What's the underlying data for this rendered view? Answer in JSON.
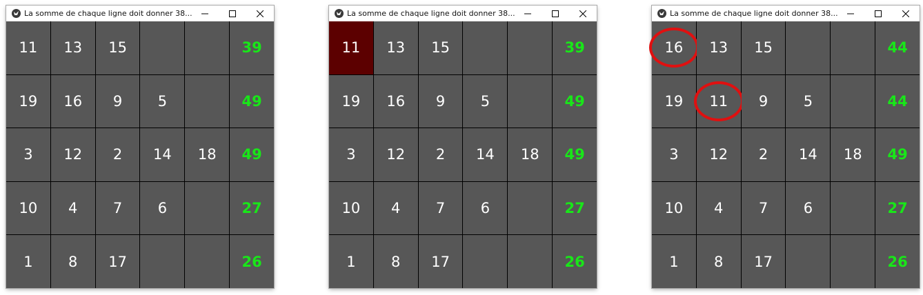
{
  "windows": [
    {
      "title": "La somme de chaque ligne doit donner 38...",
      "rows": [
        {
          "cells": [
            "11",
            "13",
            "15",
            "",
            ""
          ],
          "sum": "39"
        },
        {
          "cells": [
            "19",
            "16",
            "9",
            "5",
            ""
          ],
          "sum": "49"
        },
        {
          "cells": [
            "3",
            "12",
            "2",
            "14",
            "18"
          ],
          "sum": "49"
        },
        {
          "cells": [
            "10",
            "4",
            "7",
            "6",
            ""
          ],
          "sum": "27"
        },
        {
          "cells": [
            "1",
            "8",
            "17",
            "",
            ""
          ],
          "sum": "26"
        }
      ]
    },
    {
      "title": "La somme de chaque ligne doit donner 38...",
      "rows": [
        {
          "cells": [
            "11",
            "13",
            "15",
            "",
            ""
          ],
          "sum": "39"
        },
        {
          "cells": [
            "19",
            "16",
            "9",
            "5",
            ""
          ],
          "sum": "49"
        },
        {
          "cells": [
            "3",
            "12",
            "2",
            "14",
            "18"
          ],
          "sum": "49"
        },
        {
          "cells": [
            "10",
            "4",
            "7",
            "6",
            ""
          ],
          "sum": "27"
        },
        {
          "cells": [
            "1",
            "8",
            "17",
            "",
            ""
          ],
          "sum": "26"
        }
      ],
      "selected_cell": "row 1, column 1"
    },
    {
      "title": "La somme de chaque ligne doit donner 38...",
      "rows": [
        {
          "cells": [
            "16",
            "13",
            "15",
            "",
            ""
          ],
          "sum": "44"
        },
        {
          "cells": [
            "19",
            "11",
            "9",
            "5",
            ""
          ],
          "sum": "44"
        },
        {
          "cells": [
            "3",
            "12",
            "2",
            "14",
            "18"
          ],
          "sum": "49"
        },
        {
          "cells": [
            "10",
            "4",
            "7",
            "6",
            ""
          ],
          "sum": "27"
        },
        {
          "cells": [
            "1",
            "8",
            "17",
            "",
            ""
          ],
          "sum": "26"
        }
      ],
      "circled_cells": [
        "16",
        "11"
      ]
    }
  ],
  "colors": {
    "cell_background": "#575757",
    "grid_lines": "#000000",
    "cell_text": "#ffffff",
    "sum_text": "#19e619",
    "selected_cell": "#5c0000",
    "annotation_circle": "#e01010"
  },
  "icons": {
    "app": "kivy-app-icon",
    "minimize": "minimize-icon",
    "maximize": "maximize-icon",
    "close": "close-icon"
  }
}
